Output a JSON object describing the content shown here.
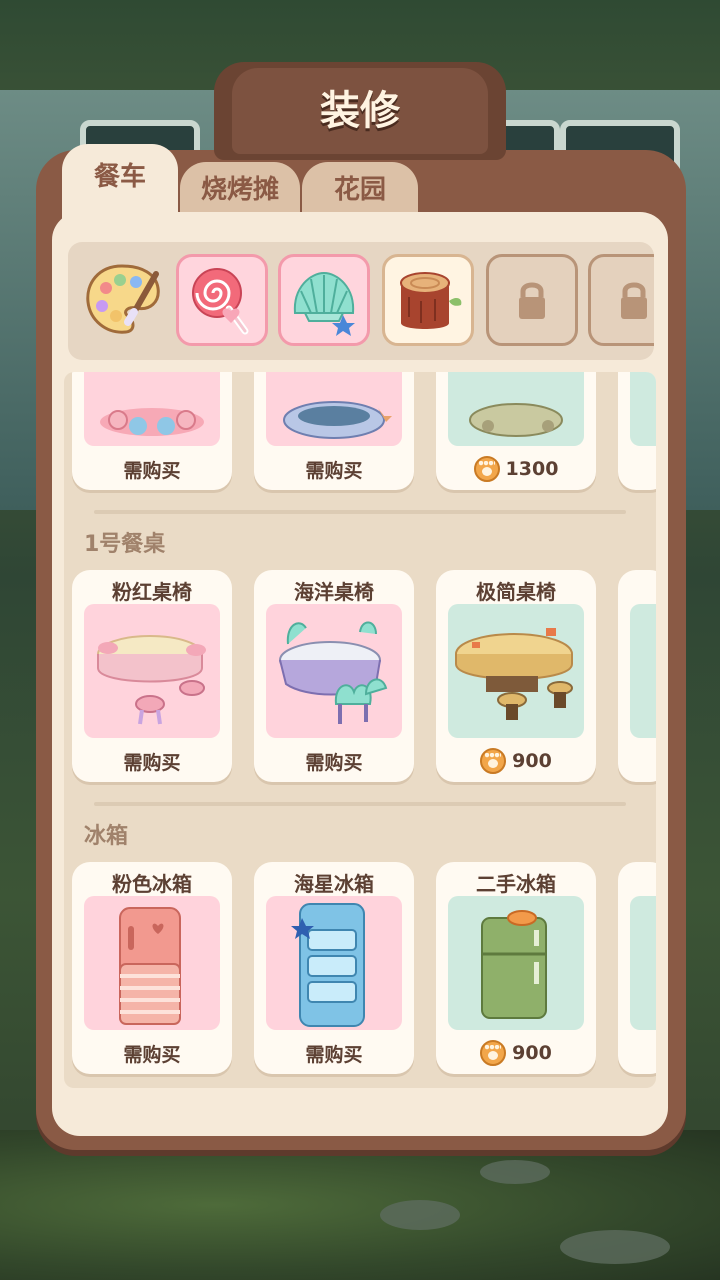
{
  "header": {
    "title": "装修"
  },
  "tabs": [
    {
      "label": "餐车",
      "active": true
    },
    {
      "label": "烧烤摊",
      "active": false
    },
    {
      "label": "花园",
      "active": false
    }
  ],
  "themes": [
    {
      "name": "palette-icon"
    },
    {
      "name": "candy-theme"
    },
    {
      "name": "shell-theme"
    },
    {
      "name": "wood-theme",
      "selected": true
    },
    {
      "name": "locked-theme",
      "locked": true
    },
    {
      "name": "locked-theme",
      "locked": true
    }
  ],
  "top_row": {
    "items": [
      {
        "status": "需购买"
      },
      {
        "status": "需购买"
      },
      {
        "price": "1300"
      }
    ]
  },
  "sections": [
    {
      "label": "1号餐桌",
      "items": [
        {
          "name": "粉红桌椅",
          "status": "需购买"
        },
        {
          "name": "海洋桌椅",
          "status": "需购买"
        },
        {
          "name": "极简桌椅",
          "price": "900"
        }
      ]
    },
    {
      "label": "冰箱",
      "items": [
        {
          "name": "粉色冰箱",
          "status": "需购买"
        },
        {
          "name": "海星冰箱",
          "status": "需购买"
        },
        {
          "name": "二手冰箱",
          "price": "900"
        }
      ]
    }
  ],
  "colors": {
    "panel_frame": "#8a5a45",
    "panel_bg": "#f6ead9",
    "pink_tile": "#ffd3dc",
    "mint_tile": "#cfeadf",
    "coin": "#f2a64a"
  }
}
